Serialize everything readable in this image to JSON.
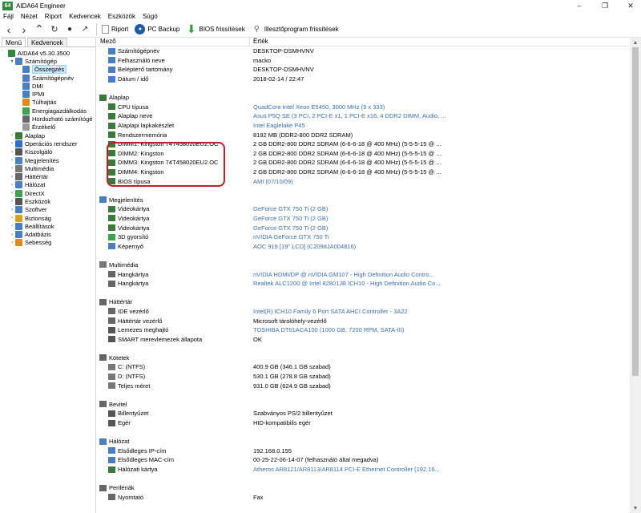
{
  "window": {
    "logo": "64",
    "title": "AIDA64 Engineer"
  },
  "menu": [
    "Fájl",
    "Nézet",
    "Riport",
    "Kedvencek",
    "Eszközök",
    "Súgó"
  ],
  "toolbar": {
    "report": "Riport",
    "pc_backup": "PC Backup",
    "bios": "BIOS frissítések",
    "drivers": "Illesztőprogram frissítések"
  },
  "left_tabs": [
    "Menü",
    "Kedvencek"
  ],
  "tree": [
    {
      "label": "AIDA64 v5.30.3500",
      "level": 0,
      "exp": "",
      "color": "#2d8a3e"
    },
    {
      "label": "Számítógép",
      "level": 1,
      "exp": "▾",
      "color": "#4a7fc1"
    },
    {
      "label": "Összegzés",
      "level": 2,
      "exp": "",
      "color": "#4a7fc1",
      "selected": true
    },
    {
      "label": "Számítógépnév",
      "level": 2,
      "exp": "",
      "color": "#4a7fc1"
    },
    {
      "label": "DMI",
      "level": 2,
      "exp": "",
      "color": "#4a7fc1"
    },
    {
      "label": "IPMI",
      "level": 2,
      "exp": "",
      "color": "#4a7fc1"
    },
    {
      "label": "Túlhajtás",
      "level": 2,
      "exp": "",
      "color": "#e08a1e"
    },
    {
      "label": "Energiagazdálkodás",
      "level": 2,
      "exp": "",
      "color": "#3fa34d"
    },
    {
      "label": "Hordozható számítógé",
      "level": 2,
      "exp": "",
      "color": "#666"
    },
    {
      "label": "Érzékelő",
      "level": 2,
      "exp": "",
      "color": "#999"
    },
    {
      "label": "Alaplap",
      "level": 1,
      "exp": "›",
      "color": "#3a7a3a"
    },
    {
      "label": "Operációs rendszer",
      "level": 1,
      "exp": "›",
      "color": "#2a6fc9"
    },
    {
      "label": "Kiszolgáló",
      "level": 1,
      "exp": "›",
      "color": "#555"
    },
    {
      "label": "Megjelenítés",
      "level": 1,
      "exp": "›",
      "color": "#4a7fc1"
    },
    {
      "label": "Multimédia",
      "level": 1,
      "exp": "›",
      "color": "#777"
    },
    {
      "label": "Háttértár",
      "level": 1,
      "exp": "›",
      "color": "#666"
    },
    {
      "label": "Hálózat",
      "level": 1,
      "exp": "›",
      "color": "#4a7fc1"
    },
    {
      "label": "DirectX",
      "level": 1,
      "exp": "›",
      "color": "#3fa34d"
    },
    {
      "label": "Eszközök",
      "level": 1,
      "exp": "›",
      "color": "#555"
    },
    {
      "label": "Szoftver",
      "level": 1,
      "exp": "›",
      "color": "#4a7fc1"
    },
    {
      "label": "Biztonság",
      "level": 1,
      "exp": "›",
      "color": "#d9a21e"
    },
    {
      "label": "Beállítások",
      "level": 1,
      "exp": "›",
      "color": "#4a7fc1"
    },
    {
      "label": "Adatbázis",
      "level": 1,
      "exp": "›",
      "color": "#4a7fc1"
    },
    {
      "label": "Sebesség",
      "level": 1,
      "exp": "›",
      "color": "#e08a1e"
    }
  ],
  "columns": {
    "field": "Mező",
    "value": "Érték"
  },
  "rows": [
    {
      "type": "row",
      "key": "Számítógépnév",
      "value": "DESKTOP-DSMHVNV",
      "icon": "#4a7fc1"
    },
    {
      "type": "row",
      "key": "Felhasználó neve",
      "value": "macko",
      "icon": "#4a7fc1"
    },
    {
      "type": "row",
      "key": "Belépteтő tartomány",
      "value": "DESKTOP-DSMHVNV",
      "icon": "#4a7fc1"
    },
    {
      "type": "row",
      "key": "Dátum / idő",
      "value": "2018-02-14 / 22:47",
      "icon": "#4a7fc1"
    },
    {
      "type": "spacer"
    },
    {
      "type": "section",
      "key": "Alaplap",
      "icon": "#3a7a3a"
    },
    {
      "type": "row",
      "key": "CPU típusa",
      "value": "QuadCore Intel Xeon E5450, 3000 MHz (9 x 333)",
      "link": true,
      "icon": "#3a7a3a"
    },
    {
      "type": "row",
      "key": "Alaplap neve",
      "value": "Asus P5Q SE  (3 PCI, 2 PCI-E x1, 1 PCI-E x16, 4 DDR2 DIMM, Audio, ...",
      "link": true,
      "icon": "#3a7a3a"
    },
    {
      "type": "row",
      "key": "Alaplapi lapkakészlet",
      "value": "Intel Eaglelake P45",
      "link": true,
      "icon": "#3a7a3a"
    },
    {
      "type": "row",
      "key": "Rendszermemória",
      "value": "8192 MB  (DDR2-800 DDR2 SDRAM)",
      "icon": "#3a7a3a"
    },
    {
      "type": "row",
      "key": "DIMM1: Kingston 74T458020EU2.OC",
      "value": "2 GB DDR2-800 DDR2 SDRAM  (6-6-6-18 @ 400 MHz)  (5-5-5-15 @ ...",
      "icon": "#3a7a3a"
    },
    {
      "type": "row",
      "key": "DIMM2: Kingston",
      "value": "2 GB DDR2-800 DDR2 SDRAM  (6-6-6-18 @ 400 MHz)  (5-5-5-15 @ ...",
      "icon": "#3a7a3a"
    },
    {
      "type": "row",
      "key": "DIMM3: Kingston 74T458020EU2.OC",
      "value": "2 GB DDR2-800 DDR2 SDRAM  (6-6-6-18 @ 400 MHz)  (5-5-5-15 @ ...",
      "icon": "#3a7a3a"
    },
    {
      "type": "row",
      "key": "DIMM4: Kingston",
      "value": "2 GB DDR2-800 DDR2 SDRAM  (6-6-6-18 @ 400 MHz)  (5-5-5-15 @ ...",
      "icon": "#3a7a3a"
    },
    {
      "type": "row",
      "key": "BIOS típusa",
      "value": "AMI (07/10/09)",
      "link": true,
      "icon": "#3a7a3a"
    },
    {
      "type": "spacer"
    },
    {
      "type": "section",
      "key": "Megjelenítés",
      "icon": "#4a7fc1"
    },
    {
      "type": "row",
      "key": "Videokártya",
      "value": "GeForce GTX 750 Ti  (2 GB)",
      "link": true,
      "icon": "#3a7a3a"
    },
    {
      "type": "row",
      "key": "Videokártya",
      "value": "GeForce GTX 750 Ti  (2 GB)",
      "link": true,
      "icon": "#3a7a3a"
    },
    {
      "type": "row",
      "key": "Videokártya",
      "value": "GeForce GTX 750 Ti  (2 GB)",
      "link": true,
      "icon": "#3a7a3a"
    },
    {
      "type": "row",
      "key": "3D gyorsító",
      "value": "nVIDIA GeForce GTX 750 Ti",
      "link": true,
      "icon": "#3fa34d"
    },
    {
      "type": "row",
      "key": "Képernyő",
      "value": "AOC 919  [19\" LCD]  (C2098JA004816)",
      "link": true,
      "icon": "#4a7fc1"
    },
    {
      "type": "spacer"
    },
    {
      "type": "section",
      "key": "Multimédia",
      "icon": "#777"
    },
    {
      "type": "row",
      "key": "Hangkártya",
      "value": "nVIDIA HDMI/DP @ nVIDIA GM107 - High Definition Audio Contro...",
      "link": true,
      "icon": "#666"
    },
    {
      "type": "row",
      "key": "Hangkártya",
      "value": "Realtek ALC1200 @ Intel 82801JB ICH10 - High Definition Audio Co...",
      "link": true,
      "icon": "#666"
    },
    {
      "type": "spacer"
    },
    {
      "type": "section",
      "key": "Háttértár",
      "icon": "#666"
    },
    {
      "type": "row",
      "key": "IDE vezérlő",
      "value": "Intel(R) ICH10 Family 6 Port SATA AHCI Controller - 3A22",
      "link": true,
      "icon": "#666"
    },
    {
      "type": "row",
      "key": "Háttértár vezérlő",
      "value": "Microsoft tárolóhely-vezérlő",
      "icon": "#666"
    },
    {
      "type": "row",
      "key": "Lemezes meghajtó",
      "value": "TOSHIBA DT01ACA100  (1000 GB, 7200 RPM, SATA-III)",
      "link": true,
      "icon": "#555"
    },
    {
      "type": "row",
      "key": "SMART merevlemezek állapota",
      "value": "OK",
      "icon": "#555"
    },
    {
      "type": "spacer"
    },
    {
      "type": "section",
      "key": "Kötetek",
      "icon": "#666"
    },
    {
      "type": "row",
      "key": "C: (NTFS)",
      "value": "400.9 GB (346.1 GB szabad)",
      "icon": "#777"
    },
    {
      "type": "row",
      "key": "D: (NTFS)",
      "value": "530.1 GB (278.8 GB szabad)",
      "icon": "#777"
    },
    {
      "type": "row",
      "key": "Teljes méret",
      "value": "931.0 GB (624.9 GB szabad)",
      "icon": "#777"
    },
    {
      "type": "spacer"
    },
    {
      "type": "section",
      "key": "Bevitel",
      "icon": "#666"
    },
    {
      "type": "row",
      "key": "Billentyűzet",
      "value": "Szabványos PS/2 billentyűzet",
      "icon": "#555"
    },
    {
      "type": "row",
      "key": "Egér",
      "value": "HID-kompatibilis egér",
      "icon": "#555"
    },
    {
      "type": "spacer"
    },
    {
      "type": "section",
      "key": "Hálózat",
      "icon": "#4a7fc1"
    },
    {
      "type": "row",
      "key": "Elsődleges IP-cím",
      "value": "192.168.0.155",
      "icon": "#4a7fc1"
    },
    {
      "type": "row",
      "key": "Elsődleges MAC-cím",
      "value": "00-25-22-06-14-07  (felhasználó által megadva)",
      "icon": "#4a7fc1"
    },
    {
      "type": "row",
      "key": "Hálózati kártya",
      "value": "Atheros AR8121/AR8113/AR8114 PCI-E Ethernet Controller  (192.16...",
      "link": true,
      "icon": "#3a7a3a"
    },
    {
      "type": "spacer"
    },
    {
      "type": "section",
      "key": "Perifériák",
      "icon": "#666"
    },
    {
      "type": "row",
      "key": "Nyomtató",
      "value": "Fax",
      "icon": "#666"
    }
  ]
}
